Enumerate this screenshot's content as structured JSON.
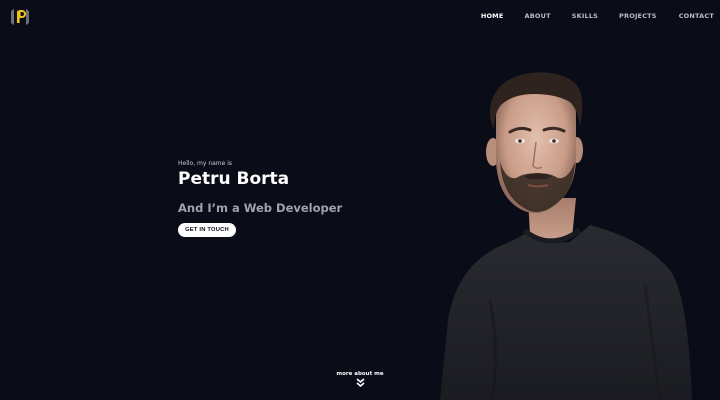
{
  "nav": {
    "items": [
      {
        "label": "HOME",
        "active": true
      },
      {
        "label": "ABOUT",
        "active": false
      },
      {
        "label": "SKILLS",
        "active": false
      },
      {
        "label": "PROJECTS",
        "active": false
      },
      {
        "label": "CONTACT",
        "active": false
      }
    ]
  },
  "hero": {
    "greeting": "Hello, my name is",
    "name": "Petru Borta",
    "role": "And I’m a Web Developer",
    "cta_label": "GET IN TOUCH"
  },
  "footer": {
    "more_label": "more about me",
    "more_icon": "double-chevron-down-icon"
  },
  "colors": {
    "background": "#0a0d17",
    "logo_accent": "#f0c419",
    "role_text": "#a0a3aa"
  },
  "logo": {
    "icon": "logo-icon"
  }
}
